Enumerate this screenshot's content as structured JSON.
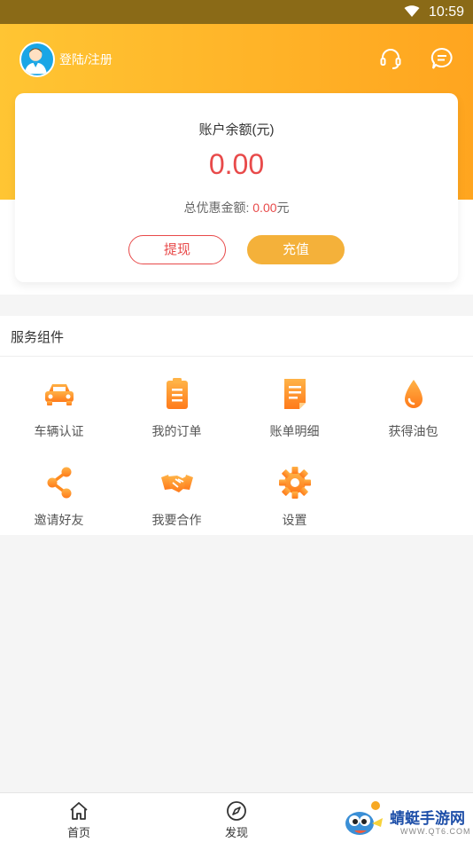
{
  "status_bar": {
    "time": "10:59",
    "wifi_icon": "wifi-icon"
  },
  "header": {
    "login_label": "登陆/注册",
    "avatar_icon": "user-avatar-icon",
    "support_icon": "headset-icon",
    "message_icon": "chat-bubble-icon"
  },
  "balance": {
    "title": "账户余额(元)",
    "amount": "0.00",
    "discount_label": "总优惠金额: ",
    "discount_value": "0.00",
    "discount_unit": "元",
    "withdraw_label": "提现",
    "recharge_label": "充值"
  },
  "services": {
    "title": "服务组件",
    "items": [
      {
        "label": "车辆认证",
        "icon": "car-icon"
      },
      {
        "label": "我的订单",
        "icon": "clipboard-icon"
      },
      {
        "label": "账单明细",
        "icon": "document-icon"
      },
      {
        "label": "获得油包",
        "icon": "oil-drop-icon"
      },
      {
        "label": "邀请好友",
        "icon": "share-icon"
      },
      {
        "label": "我要合作",
        "icon": "handshake-icon"
      },
      {
        "label": "设置",
        "icon": "gear-icon"
      }
    ]
  },
  "bottom_nav": {
    "items": [
      {
        "label": "首页",
        "icon": "home-icon"
      },
      {
        "label": "发现",
        "icon": "compass-icon"
      }
    ]
  },
  "watermark": {
    "text": "蜻蜓手游网",
    "url": "WWW.QT6.COM"
  },
  "colors": {
    "header_gradient_start": "#ffc533",
    "header_gradient_end": "#ffa51f",
    "accent_red": "#e84a4a",
    "accent_orange": "#f4b13a",
    "icon_orange": "#ff8a1f"
  }
}
